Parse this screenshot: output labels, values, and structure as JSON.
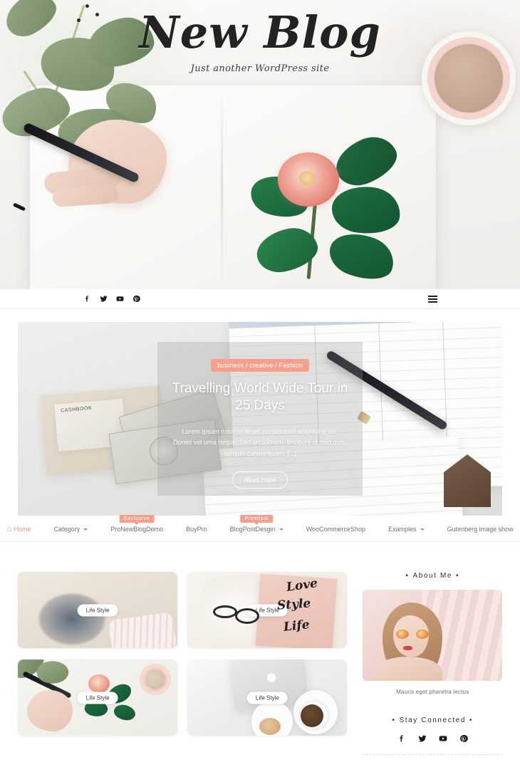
{
  "site": {
    "title": "New Blog",
    "tagline": "Just another WordPress site"
  },
  "social": {
    "icons": [
      {
        "name": "facebook-icon",
        "label": "Facebook"
      },
      {
        "name": "twitter-icon",
        "label": "Twitter"
      },
      {
        "name": "youtube-icon",
        "label": "YouTube"
      },
      {
        "name": "pinterest-icon",
        "label": "Pinterest"
      }
    ]
  },
  "topbar": {
    "menu_toggle_label": "Menu"
  },
  "slider": {
    "category": "business / creative / Fashion",
    "title": "Travelling World Wide Tour in 25 Days",
    "excerpt": "Lorem ipsum dolor sit amet, consectetur adipiscing elit. Donec vel urna neque. Sed arcu lorem, tincidunt ut odio quis, semper cursus quam. [...]",
    "button": "Read more"
  },
  "nav": {
    "items": [
      {
        "label": "Home",
        "active": true,
        "icon": "home-icon",
        "caret": false,
        "badge": null
      },
      {
        "label": "Category",
        "active": false,
        "icon": null,
        "caret": true,
        "badge": null
      },
      {
        "label": "ProNewBlogDemo",
        "active": false,
        "icon": null,
        "caret": false,
        "badge": "Exclusive"
      },
      {
        "label": "BuyPro",
        "active": false,
        "icon": null,
        "caret": false,
        "badge": null
      },
      {
        "label": "BlogPostDesgin",
        "active": false,
        "icon": null,
        "caret": true,
        "badge": "Premium"
      },
      {
        "label": "WooCommerceShop",
        "active": false,
        "icon": null,
        "caret": false,
        "badge": null
      },
      {
        "label": "Examples",
        "active": false,
        "icon": null,
        "caret": true,
        "badge": null
      },
      {
        "label": "Gutenberg image show",
        "active": false,
        "icon": null,
        "caret": false,
        "badge": null
      }
    ]
  },
  "posts": [
    {
      "category": "Life Style",
      "image": "baby-in-knit-hat"
    },
    {
      "category": "Life Style",
      "image": "love-style-life-book-with-glasses"
    },
    {
      "category": "Life Style",
      "image": "hand-painting-flower-in-notebook"
    },
    {
      "category": "Life Style",
      "image": "laptop-and-coffee-in-bed"
    }
  ],
  "sidebar": {
    "about": {
      "title": "About Me",
      "caption": "Mauris eget pharetra lectus",
      "image": "woman-with-sunglasses"
    },
    "connected": {
      "title": "Stay Connected"
    }
  },
  "colors": {
    "accent": "#f0a18d",
    "accent_strong": "#f5a08c",
    "text": "#2e2e2e",
    "muted": "#6f6f6f"
  },
  "decor": {
    "cashbook_label": "CASHBOOK",
    "book_words": [
      "Love",
      "Style",
      "Life"
    ]
  }
}
